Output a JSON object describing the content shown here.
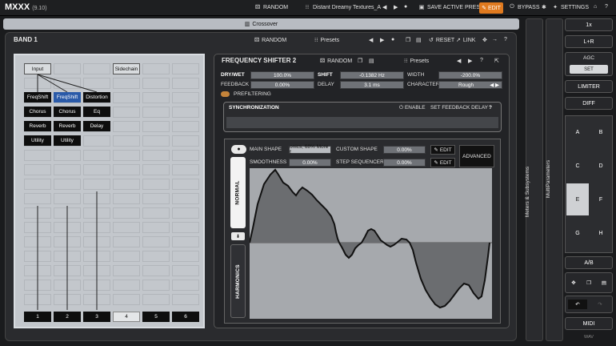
{
  "app": {
    "name": "MXXX",
    "version": "(9.10)"
  },
  "topbar": {
    "random": "RANDOM",
    "preset": "Distant Dreamy Textures_A",
    "save": "SAVE ACTIVE PRESET",
    "edit": "EDIT",
    "bypass": "BYPASS",
    "settings": "SETTINGS",
    "help": "?"
  },
  "crossover": "Crossover",
  "band": {
    "title": "BAND 1",
    "random": "RANDOM",
    "presets": "Presets",
    "reset": "RESET",
    "link": "LINK",
    "help": "?"
  },
  "routing": {
    "input": "Input",
    "sidechain": "Sidechain",
    "columns": [
      [
        "FreqShift",
        "Chorus",
        "Reverb",
        "Utility"
      ],
      [
        "FreqShift",
        "Chorus",
        "Reverb",
        "Utility"
      ],
      [
        "Distortion",
        "Eq",
        "Delay"
      ]
    ],
    "outputs": [
      "1",
      "2",
      "3",
      "4",
      "5",
      "6"
    ]
  },
  "fx": {
    "title": "FREQUENCY SHIFTER 2",
    "random": "RANDOM",
    "presets": "Presets",
    "help": "?",
    "drywet_label": "DRY/WET",
    "drywet": "100.0%",
    "shift_label": "SHIFT",
    "shift": "-0.1382 Hz",
    "width_label": "WIDTH",
    "width": "-200.0%",
    "feedback_label": "FEEDBACK",
    "feedback": "0.00%",
    "delay_label": "DELAY",
    "delay": "3.1 ms",
    "character_label": "CHARACTER",
    "character": "Rough",
    "prefiltering": "PREFILTERING"
  },
  "sync": {
    "title": "SYNCHRONIZATION",
    "enable": "ENABLE",
    "set_feedback_delay": "SET FEEDBACK DELAY",
    "help": "?"
  },
  "mod": {
    "main_shape_label": "MAIN SHAPE",
    "main_shape": "onics, 68% More f",
    "custom_shape_label": "CUSTOM SHAPE",
    "custom_shape": "0.00%",
    "smoothness_label": "SMOOTHNESS",
    "smoothness": "0.00%",
    "step_sequencer_label": "STEP SEQUENCER",
    "step_sequencer": "0.00%",
    "edit1": "EDIT",
    "edit2": "EDIT",
    "advanced": "ADVANCED",
    "tab_normal": "NORMAL",
    "tab_harmonics": "HARMONICS"
  },
  "side": {
    "meters": "Meters & Subsystems",
    "multiparams": "MultiParameters"
  },
  "right": {
    "zoom": "1x",
    "lr": "L+R",
    "agc": "AGC",
    "set": "SET",
    "limiter": "LIMITER",
    "diff": "DIFF",
    "ab_slots": [
      "A",
      "B",
      "C",
      "D",
      "E",
      "F",
      "G",
      "H"
    ],
    "ab": "A/B",
    "midi": "MIDI",
    "wav": "WAV"
  },
  "colors": {
    "accent": "#e07a1f",
    "selected": "#2a5aa8"
  }
}
